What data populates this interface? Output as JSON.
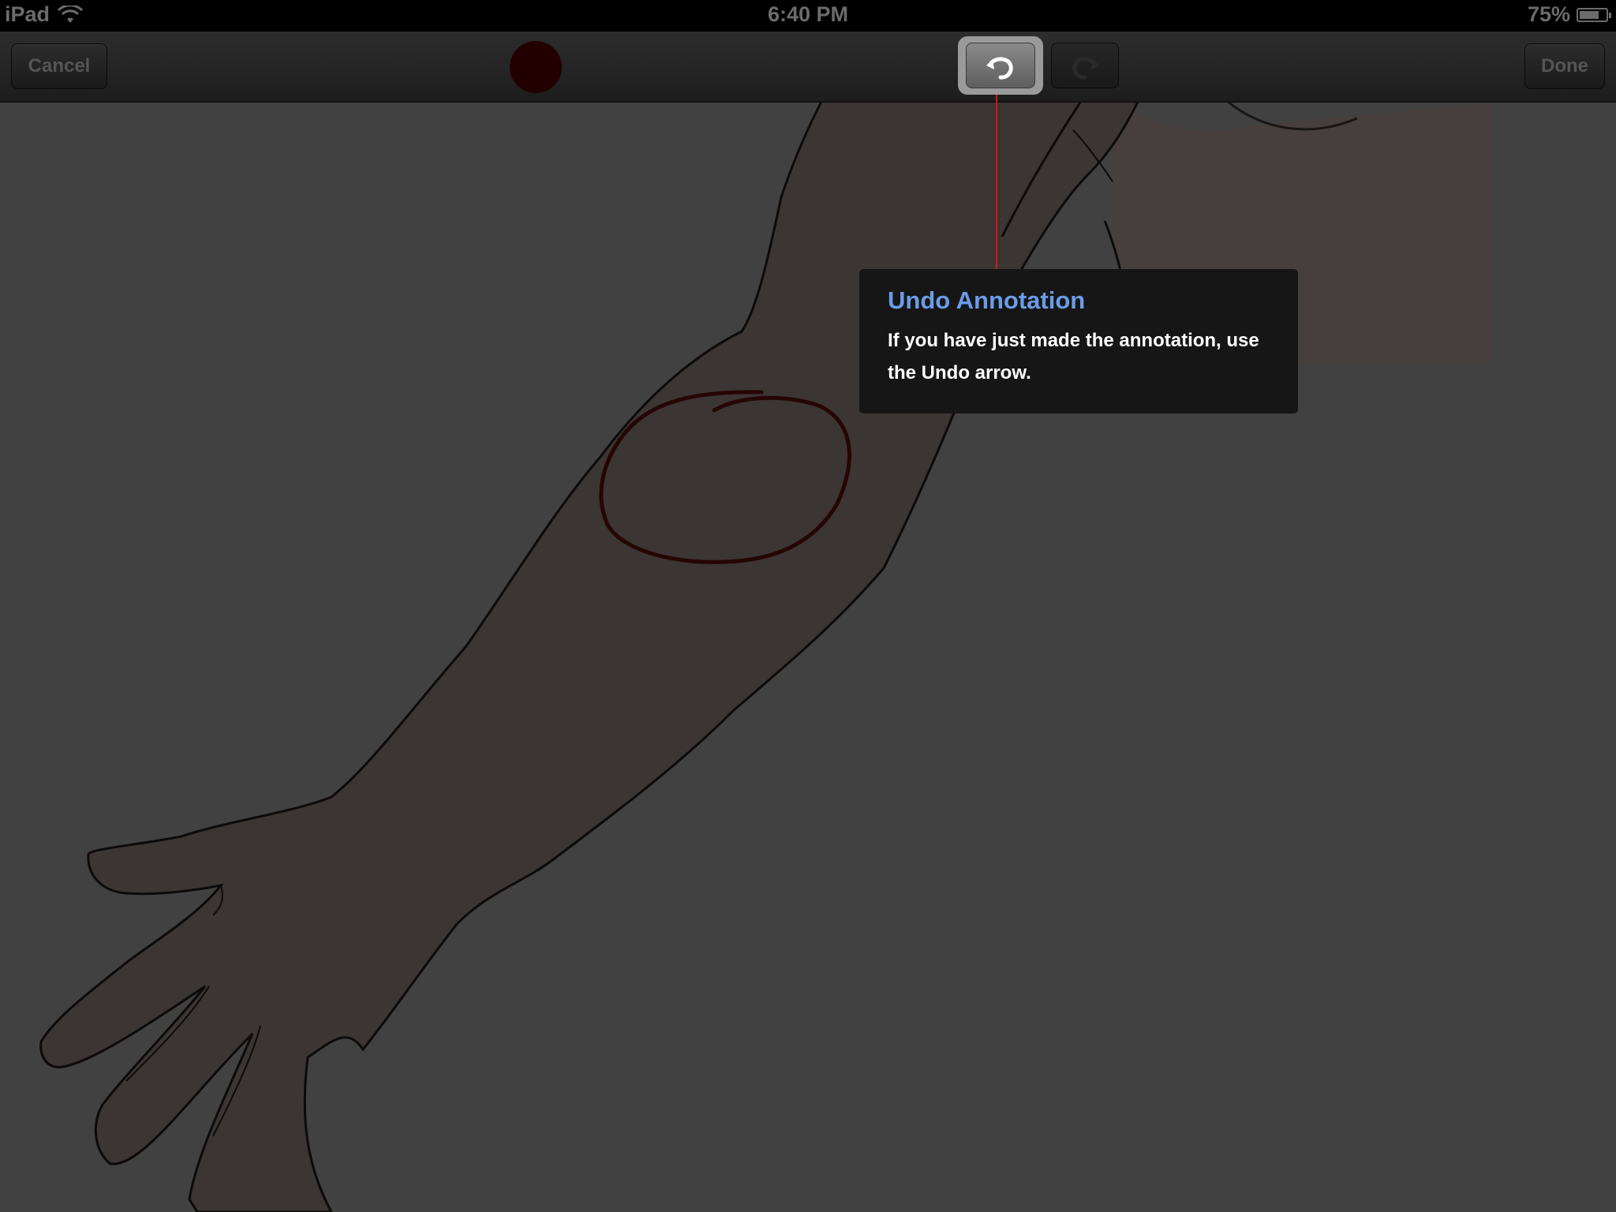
{
  "status_bar": {
    "carrier": "iPad",
    "time": "6:40 PM",
    "battery_percent_label": "75%",
    "battery_level": 0.75,
    "wifi_icon": "wifi-icon",
    "battery_icon": "battery-icon"
  },
  "toolbar": {
    "cancel_label": "Cancel",
    "done_label": "Done",
    "pen_color": "#230000",
    "undo_icon": "undo-arrow-icon",
    "redo_icon": "redo-arrow-icon"
  },
  "tooltip": {
    "title": "Undo Annotation",
    "body": "If you have just made the annotation, use the Undo arrow."
  },
  "colors": {
    "overlay": "#414141",
    "tooltip_bg": "#161616",
    "tooltip_title": "#6b9ce8",
    "pointer_line": "#d01818"
  }
}
